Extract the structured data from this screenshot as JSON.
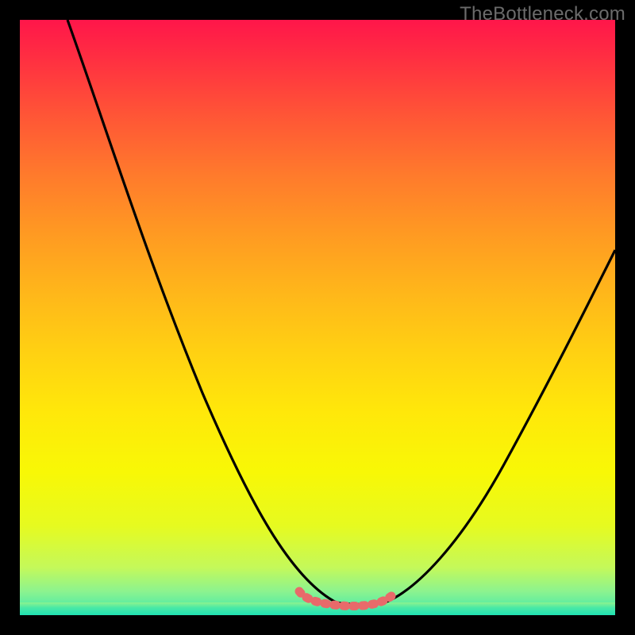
{
  "attribution": "TheBottleneck.com",
  "colors": {
    "frame": "#000000",
    "attribution_text": "#6b6b6b",
    "curve": "#000000",
    "bottom_marker": "#e86a6a",
    "gradient_top": "#ff164a",
    "gradient_bottom": "#20e1b3"
  },
  "chart_data": {
    "type": "line",
    "title": "",
    "xlabel": "",
    "ylabel": "",
    "xlim": [
      0,
      100
    ],
    "ylim": [
      0,
      100
    ],
    "grid": false,
    "legend": false,
    "annotations": [
      "TheBottleneck.com"
    ],
    "series": [
      {
        "name": "bottleneck-curve",
        "x": [
          8,
          12,
          16,
          20,
          24,
          28,
          32,
          36,
          40,
          44,
          47,
          50,
          53,
          55,
          58,
          60,
          65,
          70,
          75,
          80,
          85,
          90,
          95,
          100
        ],
        "y": [
          100,
          90,
          80,
          70,
          61,
          52,
          43,
          35,
          27,
          19,
          12,
          7,
          3,
          2,
          2,
          3,
          7,
          13,
          20,
          28,
          37,
          46,
          55,
          62
        ]
      },
      {
        "name": "stable-zone-marker",
        "x": [
          47,
          49,
          51,
          53,
          55,
          57,
          59,
          61
        ],
        "y": [
          3,
          2.2,
          2,
          2,
          2,
          2.1,
          2.4,
          3.2
        ]
      }
    ]
  }
}
